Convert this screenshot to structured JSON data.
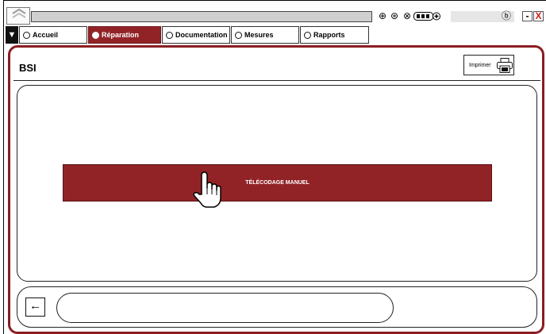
{
  "window": {
    "title": "",
    "status_icons": [
      "download-icon",
      "user-icon",
      "settings-icon",
      "battery-icon"
    ],
    "info_icon": "info-icon",
    "minimize_label": "-",
    "close_label": "X",
    "accent_color": "#912327"
  },
  "tabs": [
    {
      "label": "Accueil",
      "active": false
    },
    {
      "label": "Réparation",
      "active": true
    },
    {
      "label": "Documentation",
      "active": false
    },
    {
      "label": "Mesures",
      "active": false
    },
    {
      "label": "Rapports",
      "active": false
    }
  ],
  "panel": {
    "title": "BSI",
    "print_label": "Imprimer",
    "action_label": "TÉLÉCODAGE MANUEL",
    "back_label": "←",
    "message": ""
  }
}
